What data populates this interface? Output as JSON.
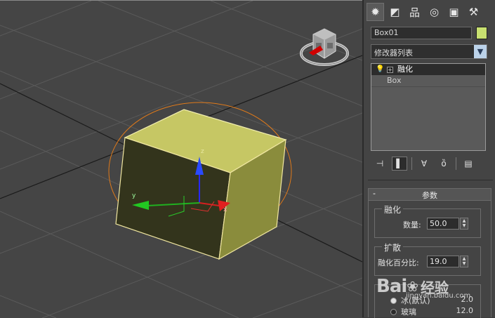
{
  "viewport": {
    "object_color": "#c8c860",
    "gizmo_label_x": "x",
    "gizmo_label_y": "y",
    "gizmo_label_z": "z"
  },
  "command_panel": {
    "tabs": [
      {
        "name": "create-tab",
        "icon": "sun-icon",
        "glyph": "✹",
        "active": true
      },
      {
        "name": "modify-tab",
        "icon": "curve-icon",
        "glyph": "◩",
        "active": false
      },
      {
        "name": "hierarchy-tab",
        "icon": "hierarchy-icon",
        "glyph": "品",
        "active": false
      },
      {
        "name": "motion-tab",
        "icon": "motion-icon",
        "glyph": "◎",
        "active": false
      },
      {
        "name": "display-tab",
        "icon": "monitor-icon",
        "glyph": "▣",
        "active": false
      },
      {
        "name": "utilities-tab",
        "icon": "hammer-icon",
        "glyph": "⚒",
        "active": false
      }
    ],
    "object_name": "Box01",
    "object_color": "#c8e070",
    "modifier_list_label": "修改器列表",
    "stack": {
      "modifier": "融化",
      "base": "Box"
    },
    "tools": [
      {
        "name": "pin-stack-button",
        "icon": "pin-icon",
        "glyph": "⊣",
        "pressed": false
      },
      {
        "name": "show-end-result-button",
        "icon": "end-result-icon",
        "glyph": "▌",
        "pressed": true
      },
      {
        "name": "make-unique-button",
        "icon": "make-unique-icon",
        "glyph": "∀",
        "pressed": false
      },
      {
        "name": "remove-modifier-button",
        "icon": "trash-icon",
        "glyph": "ȍ",
        "pressed": false
      },
      {
        "name": "configure-modifier-sets-button",
        "icon": "configure-icon",
        "glyph": "▤",
        "pressed": false
      }
    ],
    "rollout": {
      "toggle": "-",
      "title": "参数",
      "melt_group": {
        "title": "融化",
        "amount_label": "数量:",
        "amount_value": "50.0"
      },
      "spread_group": {
        "title": "扩散",
        "spread_label": "融化百分比:",
        "spread_value": "19.0"
      },
      "solidity_group": {
        "options": [
          {
            "label": "冰(默认)",
            "value": "2.0",
            "on": true
          },
          {
            "label": "玻璃",
            "value": "12.0",
            "on": false
          }
        ]
      }
    }
  },
  "watermark": {
    "brand": "Bai",
    "brand_suffix": "经验",
    "url": "jingyan.baidu.com"
  }
}
